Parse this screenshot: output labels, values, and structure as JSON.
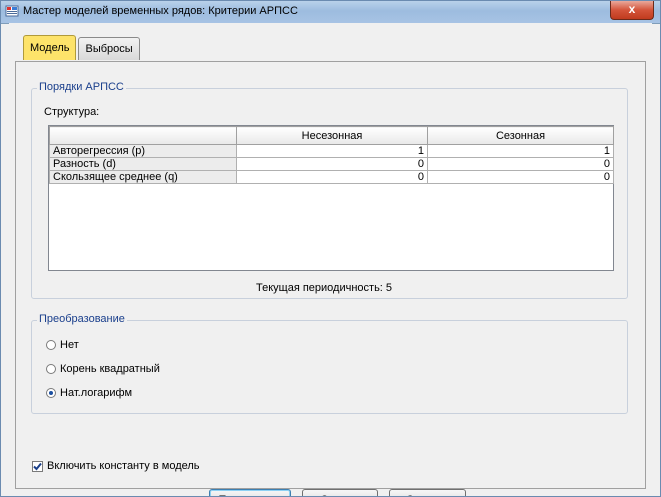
{
  "window": {
    "title": "Мастер моделей временных рядов: Критерии АРПСС",
    "close_label": "x"
  },
  "tabs": [
    {
      "label": "Модель",
      "active": true
    },
    {
      "label": "Выбросы",
      "active": false
    }
  ],
  "orders_group": {
    "title": "Порядки АРПСС",
    "structure_label": "Структура:",
    "columns": [
      "",
      "Несезонная",
      "Сезонная"
    ],
    "rows": [
      {
        "label": "Авторегрессия (p)",
        "nonseasonal": "1",
        "seasonal": "1"
      },
      {
        "label": "Разность (d)",
        "nonseasonal": "0",
        "seasonal": "0"
      },
      {
        "label": "Скользящее среднее (q)",
        "nonseasonal": "0",
        "seasonal": "0"
      }
    ],
    "periodicity": "Текущая периодичность: 5"
  },
  "transform_group": {
    "title": "Преобразование",
    "options": [
      {
        "label": "Нет",
        "selected": false
      },
      {
        "label": "Корень квадратный",
        "selected": false
      },
      {
        "label": "Нат.логарифм",
        "selected": true
      }
    ]
  },
  "constant_checkbox": {
    "label": "Включить константу в модель",
    "checked": true
  },
  "buttons": {
    "continue": "Продолжить",
    "cancel": "Отмена",
    "help": "Справка"
  },
  "colors": {
    "active_tab": "#fde36a",
    "group_title": "#1a3f8c",
    "title_bar": "#b9d1ea",
    "close_button": "#c8402a"
  }
}
